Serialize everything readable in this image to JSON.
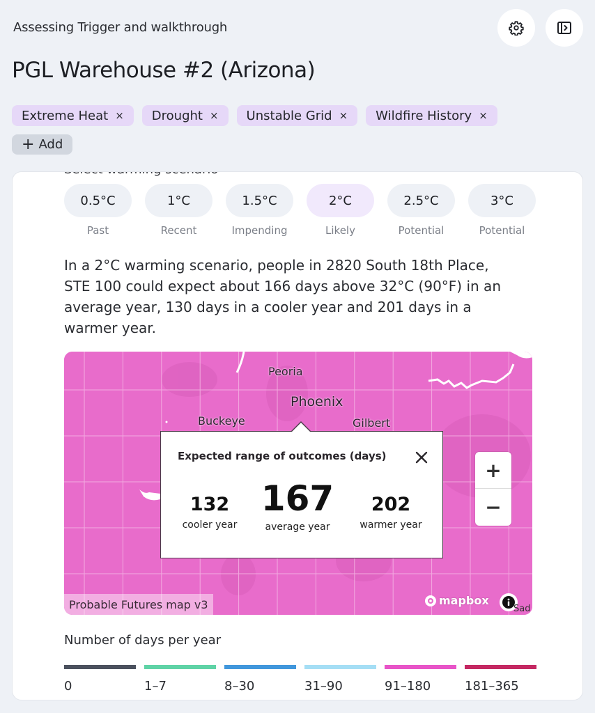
{
  "header": {
    "subtitle": "Assessing Trigger and walkthrough",
    "title": "PGL Warehouse #2 (Arizona)",
    "settings_icon": "gear-icon",
    "panel_icon": "sidebar-expand-icon"
  },
  "tags": [
    {
      "label": "Extreme Heat",
      "remove": "×"
    },
    {
      "label": "Drought",
      "remove": "×"
    },
    {
      "label": "Unstable Grid",
      "remove": "×"
    },
    {
      "label": "Wildfire History",
      "remove": "×"
    }
  ],
  "add_tag": {
    "icon": "+",
    "label": "Add"
  },
  "card": {
    "section_label": "Select warming scenario",
    "scenarios": [
      {
        "value": "0.5°C",
        "label": "Past",
        "active": false
      },
      {
        "value": "1°C",
        "label": "Recent",
        "active": false
      },
      {
        "value": "1.5°C",
        "label": "Impending",
        "active": false
      },
      {
        "value": "2°C",
        "label": "Likely",
        "active": true
      },
      {
        "value": "2.5°C",
        "label": "Potential",
        "active": false
      },
      {
        "value": "3°C",
        "label": "Potential",
        "active": false
      }
    ],
    "description": "In a 2°C warming scenario, people in 2820 South 18th Place, STE 100 could expect about 166 days above 32°C (90°F) in an average year, 130 days in a cooler year and 201 days in a warmer year."
  },
  "map": {
    "fill_color": "#e86ccb",
    "places": {
      "peoria": "Peoria",
      "phoenix": "Phoenix",
      "buckeye": "Buckeye",
      "gilbert": "Gilbert",
      "cut_town": "Sad"
    },
    "popup": {
      "title": "Expected range of outcomes (days)",
      "cooler": {
        "value": "132",
        "label": "cooler year"
      },
      "average": {
        "value": "167",
        "label": "average year"
      },
      "warmer": {
        "value": "202",
        "label": "warmer year"
      }
    },
    "zoom_in": "+",
    "zoom_out": "−",
    "attribution": "Probable Futures map v3",
    "logo": "mapbox"
  },
  "legend": {
    "title": "Number of days per year",
    "items": [
      {
        "label": "0",
        "color": "#4b515e"
      },
      {
        "label": "1–7",
        "color": "#5fd3a6"
      },
      {
        "label": "8–30",
        "color": "#4197dc"
      },
      {
        "label": "31–90",
        "color": "#a5def5"
      },
      {
        "label": "91–180",
        "color": "#e854c8"
      },
      {
        "label": "181–365",
        "color": "#c42862"
      }
    ]
  }
}
